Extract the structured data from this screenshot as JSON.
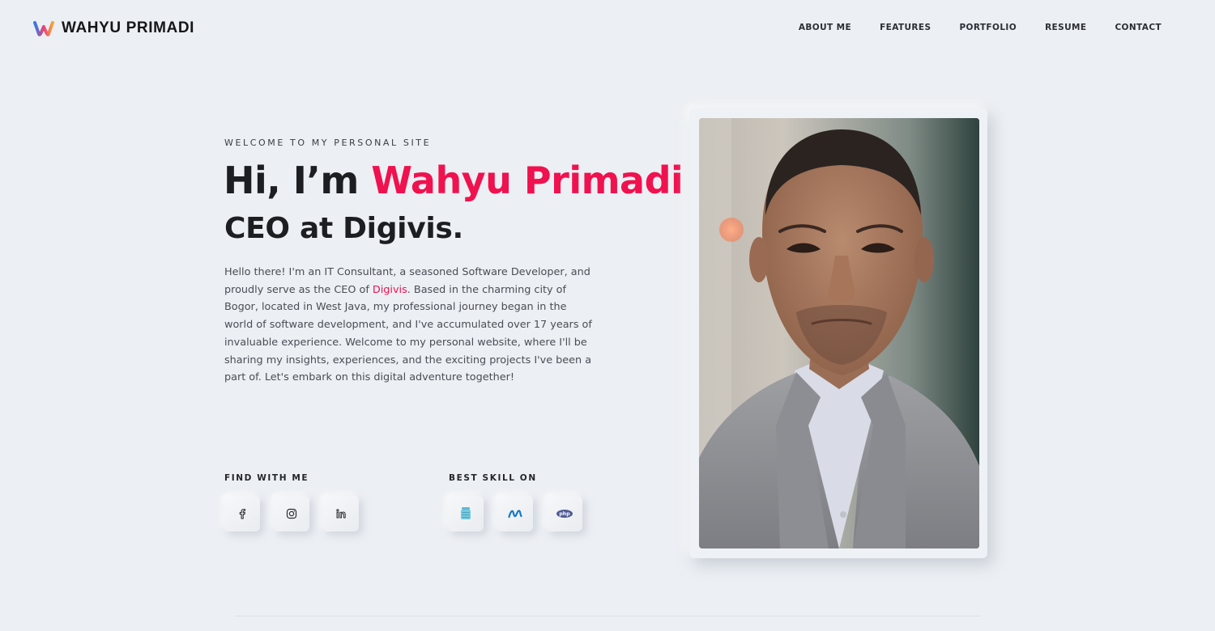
{
  "brand": {
    "name": "WAHYU PRIMADI",
    "logo_icon": "w-logo-icon"
  },
  "nav": [
    {
      "label": "ABOUT ME"
    },
    {
      "label": "FEATURES"
    },
    {
      "label": "PORTFOLIO"
    },
    {
      "label": "RESUME"
    },
    {
      "label": "CONTACT"
    }
  ],
  "hero": {
    "welcome": "WELCOME TO MY PERSONAL SITE",
    "greeting": "Hi, I’m ",
    "name": "Wahyu Primadi",
    "subtitle": "CEO at Digivis.",
    "bio_before_link": "Hello there! I'm an IT Consultant, a seasoned Software Developer, and proudly serve as the CEO of ",
    "bio_link": "Digivis",
    "bio_after_link": ". Based in the charming city of Bogor, located in West Java, my professional journey began in the world of software development, and I've accumulated over 17 years of invaluable experience. Welcome to my personal website, where I'll be sharing my insights, experiences, and the exciting projects I've been a part of. Let's embark on this digital adventure together!",
    "accent_color": "#f0114f"
  },
  "find": {
    "label": "FIND WITH ME",
    "icons": [
      "facebook-icon",
      "instagram-icon",
      "linkedin-icon"
    ]
  },
  "skills": {
    "label": "BEST SKILL ON",
    "icons": [
      "database-icon",
      "dotnet-icon",
      "php-icon"
    ]
  },
  "photo": {
    "alt": "portrait-photo"
  }
}
